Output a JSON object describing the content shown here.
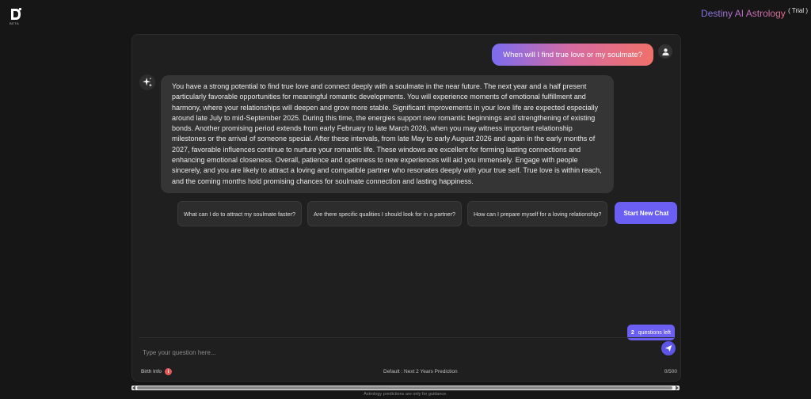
{
  "header": {
    "logo_badge": "BETA",
    "brand_name": "Destiny AI Astrology",
    "brand_suffix": "( Trial )"
  },
  "chat": {
    "user_message": "When will I find true love or my soulmate?",
    "ai_message": "You have a strong potential to find true love and connect deeply with a soulmate in the near future. The next year and a half present particularly favorable opportunities for meaningful romantic developments. You will experience moments of emotional fulfillment and harmony, where your relationships will deepen and grow more stable. Significant improvements in your love life are expected especially around late July to mid-September 2025. During this time, the energies support new romantic beginnings and strengthening of existing bonds. Another promising period extends from early February to late March 2026, when you may witness important relationship milestones or the arrival of someone special. After these intervals, from late May to early August 2026 and again in the early months of 2027, favorable influences continue to nurture your romantic life. These windows are excellent for forming lasting connections and enhancing emotional closeness. Overall, patience and openness to new experiences will aid you immensely. Engage with people sincerely, and you are likely to attract a loving and compatible partner who resonates deeply with your true self. True love is within reach, and the coming months hold promising chances for soulmate connection and lasting happiness."
  },
  "suggestions": [
    "What can I do to attract my soulmate faster?",
    "Are there specific qualities I should look for in a partner?",
    "How can I prepare myself for a loving relationship?"
  ],
  "start_new_chat_label": "Start New Chat",
  "questions_left": {
    "count": "2",
    "label": "questions left"
  },
  "input": {
    "placeholder": "Type your question here...",
    "value": ""
  },
  "footer": {
    "birth_info_label": "Birth Info",
    "birth_info_badge": "i",
    "default_prediction": "Default : Next 2 Years Prediction",
    "char_count": "0/500"
  },
  "disclaimer": "Astrology predictions are only for guidance.",
  "icons": {
    "logo": "destiny-logo-icon",
    "user_avatar": "user-icon",
    "ai_avatar": "sparkle-icon",
    "send": "send-icon",
    "info": "info-icon"
  },
  "colors": {
    "background": "#161616",
    "panel": "#1f1f1f",
    "ai_bubble": "#353535",
    "accent": "#6b5ef2",
    "user_bubble_gradient": [
      "#7b6cf0",
      "#d76ba0",
      "#f0716a"
    ],
    "info_badge": "#e8595a"
  }
}
